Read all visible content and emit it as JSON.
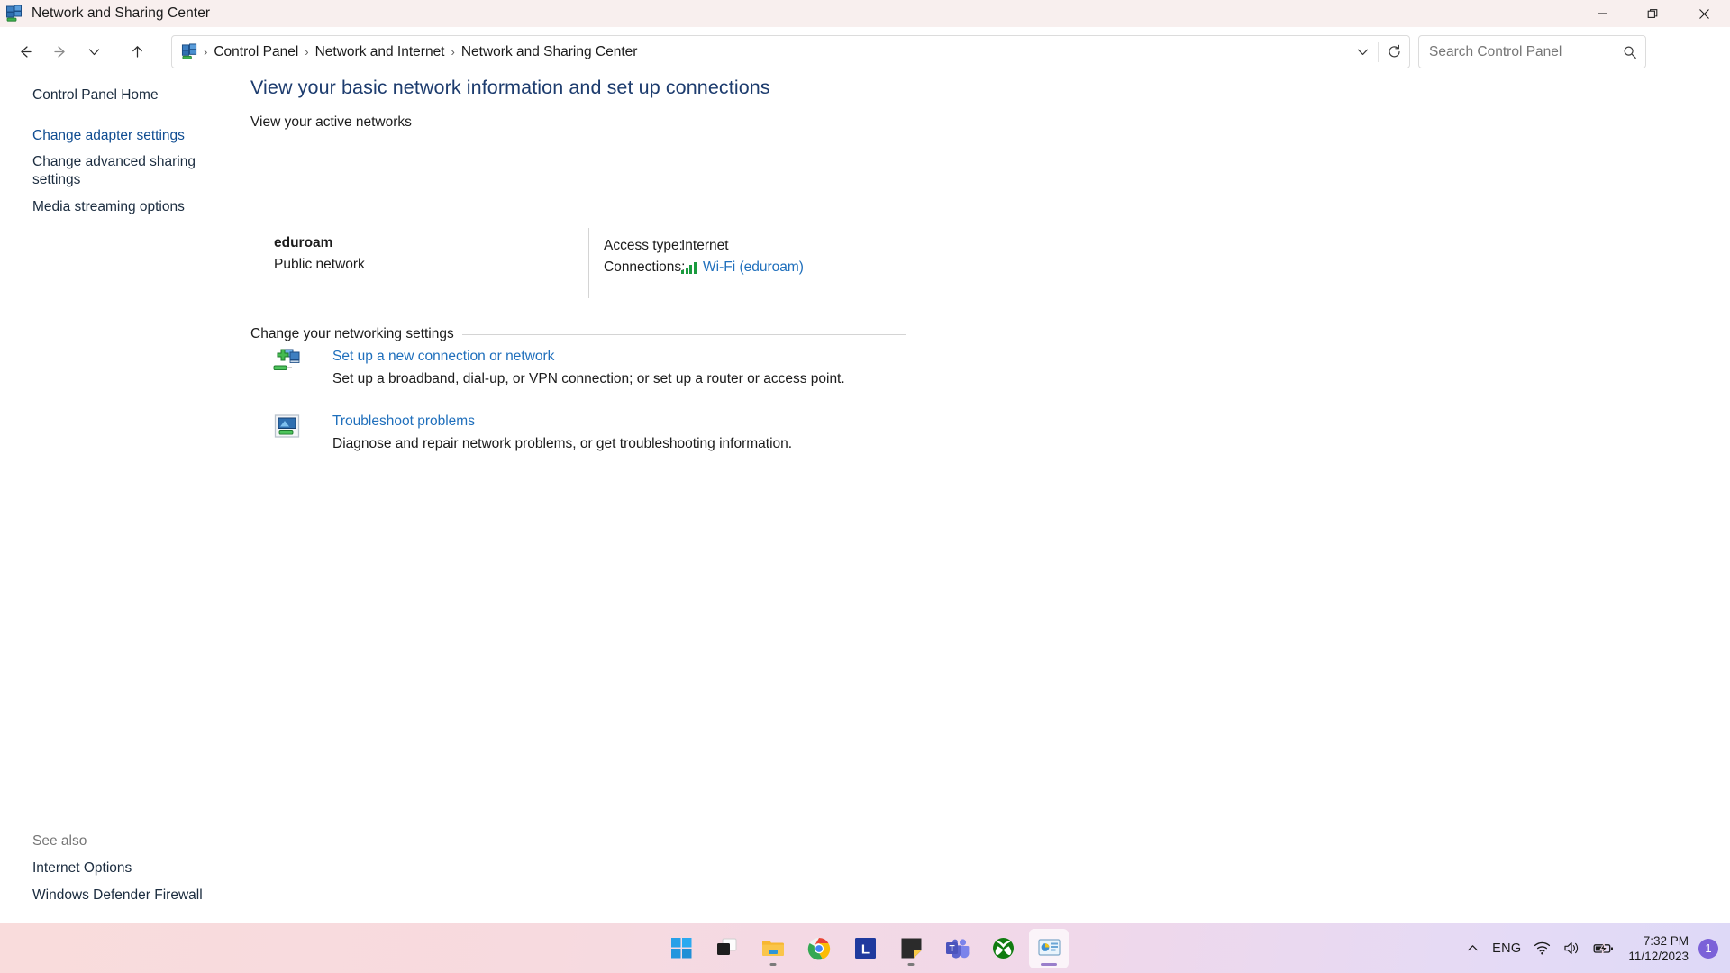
{
  "window": {
    "title": "Network and Sharing Center",
    "app_icon": "network-monitors-icon",
    "controls": {
      "minimize": "minimize-button",
      "restore": "restore-button",
      "close": "close-button"
    }
  },
  "navbar": {
    "back": "Back",
    "forward": "Forward",
    "recent": "Recent locations",
    "up": "Up",
    "breadcrumbs": [
      {
        "label": "Control Panel"
      },
      {
        "label": "Network and Internet"
      },
      {
        "label": "Network and Sharing Center"
      }
    ],
    "separator": "›",
    "history_dropdown": "chevron-down-icon",
    "refresh": "refresh-icon",
    "search": {
      "placeholder": "Search Control Panel",
      "value": "",
      "icon": "search-icon"
    }
  },
  "sidebar": {
    "items": [
      {
        "label": "Control Panel Home",
        "state": "normal"
      },
      {
        "label": "Change adapter settings",
        "state": "hovered"
      },
      {
        "label": "Change advanced sharing\nsettings",
        "state": "normal"
      },
      {
        "label": "Media streaming options",
        "state": "normal"
      }
    ],
    "see_also_heading": "See also",
    "see_also": [
      {
        "label": "Internet Options"
      },
      {
        "label": "Windows Defender Firewall"
      }
    ]
  },
  "main": {
    "page_title": "View your basic network information and set up connections",
    "groups": {
      "active_networks": "View your active networks",
      "networking_settings": "Change your networking settings"
    },
    "active_network": {
      "name": "eduroam",
      "type": "Public network",
      "access_type_label": "Access type:",
      "access_type_value": "Internet",
      "connections_label": "Connections:",
      "connections_value": "Wi-Fi (eduroam)",
      "connections_icon": "wifi-signal-bars-icon"
    },
    "tasks": [
      {
        "link": "Set up a new connection or network",
        "description": "Set up a broadband, dial-up, or VPN connection; or set up a router or access point.",
        "icon": "new-connection-icon"
      },
      {
        "link": "Troubleshoot problems",
        "description": "Diagnose and repair network problems, or get troubleshooting information.",
        "icon": "troubleshoot-monitor-icon"
      }
    ]
  },
  "taskbar": {
    "apps": [
      {
        "name": "start-button",
        "label": "Start",
        "running": false,
        "active": false
      },
      {
        "name": "task-view-button",
        "label": "Task View",
        "running": false,
        "active": false
      },
      {
        "name": "file-explorer-button",
        "label": "File Explorer",
        "running": true,
        "active": false
      },
      {
        "name": "chrome-button",
        "label": "Google Chrome",
        "running": true,
        "active": false
      },
      {
        "name": "lastpass-button",
        "label": "L",
        "running": false,
        "active": false
      },
      {
        "name": "sticky-notes-button",
        "label": "Sticky Notes",
        "running": true,
        "active": false
      },
      {
        "name": "teams-button",
        "label": "Microsoft Teams",
        "running": false,
        "active": false
      },
      {
        "name": "xbox-button",
        "label": "Xbox",
        "running": false,
        "active": false
      },
      {
        "name": "control-panel-button",
        "label": "Network and Sharing Center",
        "running": true,
        "active": true
      }
    ],
    "tray": {
      "overflow": "chevron-up-icon",
      "language": "ENG",
      "wifi": "wifi-icon",
      "volume": "volume-icon",
      "battery": "battery-charging-icon",
      "time": "7:32 PM",
      "date": "11/12/2023",
      "notification_count": "1"
    }
  },
  "colors": {
    "title_link": "#1d3c6e",
    "link": "#1f6fbc",
    "hover_link": "#0f4c91",
    "titlebar_bg": "#f8efee",
    "signal_green": "#1a9b3f",
    "badge_purple": "#7b61d8"
  }
}
